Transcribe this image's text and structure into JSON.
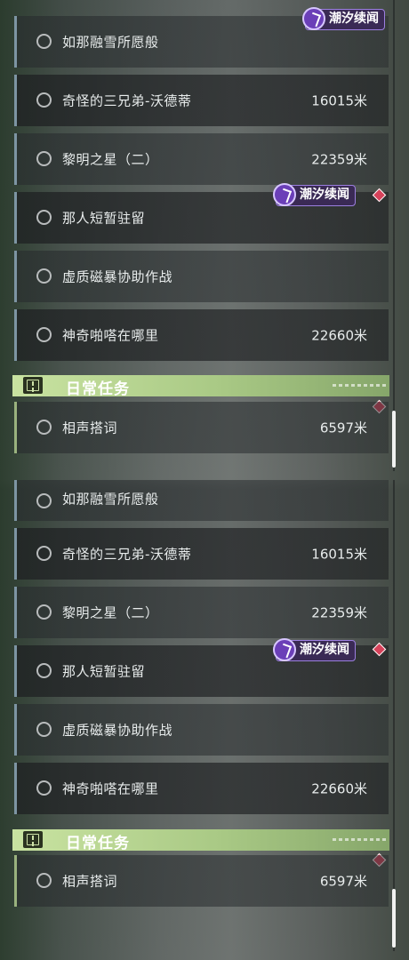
{
  "screens": [
    {
      "event_badge_top": "潮汐续闻",
      "quests": [
        {
          "name": "如那融雪所愿般",
          "distance": ""
        },
        {
          "name": "奇怪的三兄弟-沃德蒂",
          "distance": "16015米"
        },
        {
          "name": "黎明之星（二）",
          "distance": "22359米"
        },
        {
          "name": "那人短暂驻留",
          "distance": "",
          "badge": "潮汐续闻"
        },
        {
          "name": "虚质磁暴协助作战",
          "distance": ""
        },
        {
          "name": "神奇啪嗒在哪里",
          "distance": "22660米"
        }
      ],
      "daily_section": {
        "title": "日常任务",
        "quests": [
          {
            "name": "相声搭词",
            "distance": "6597米"
          }
        ]
      }
    },
    {
      "quests": [
        {
          "name": "如那融雪所愿般",
          "distance": ""
        },
        {
          "name": "奇怪的三兄弟-沃德蒂",
          "distance": "16015米"
        },
        {
          "name": "黎明之星（二）",
          "distance": "22359米"
        },
        {
          "name": "那人短暂驻留",
          "distance": "",
          "badge": "潮汐续闻"
        },
        {
          "name": "虚质磁暴协助作战",
          "distance": ""
        },
        {
          "name": "神奇啪嗒在哪里",
          "distance": "22660米"
        }
      ],
      "daily_section": {
        "title": "日常任务",
        "quests": [
          {
            "name": "相声搭词",
            "distance": "6597米"
          }
        ]
      }
    }
  ],
  "colors": {
    "main_quest_accent": "#7d95a3",
    "daily_accent": "#9ab27e",
    "daily_header": "#b6d48f",
    "event_badge": "#9c7fe0",
    "track_marker": "#d6425a"
  }
}
